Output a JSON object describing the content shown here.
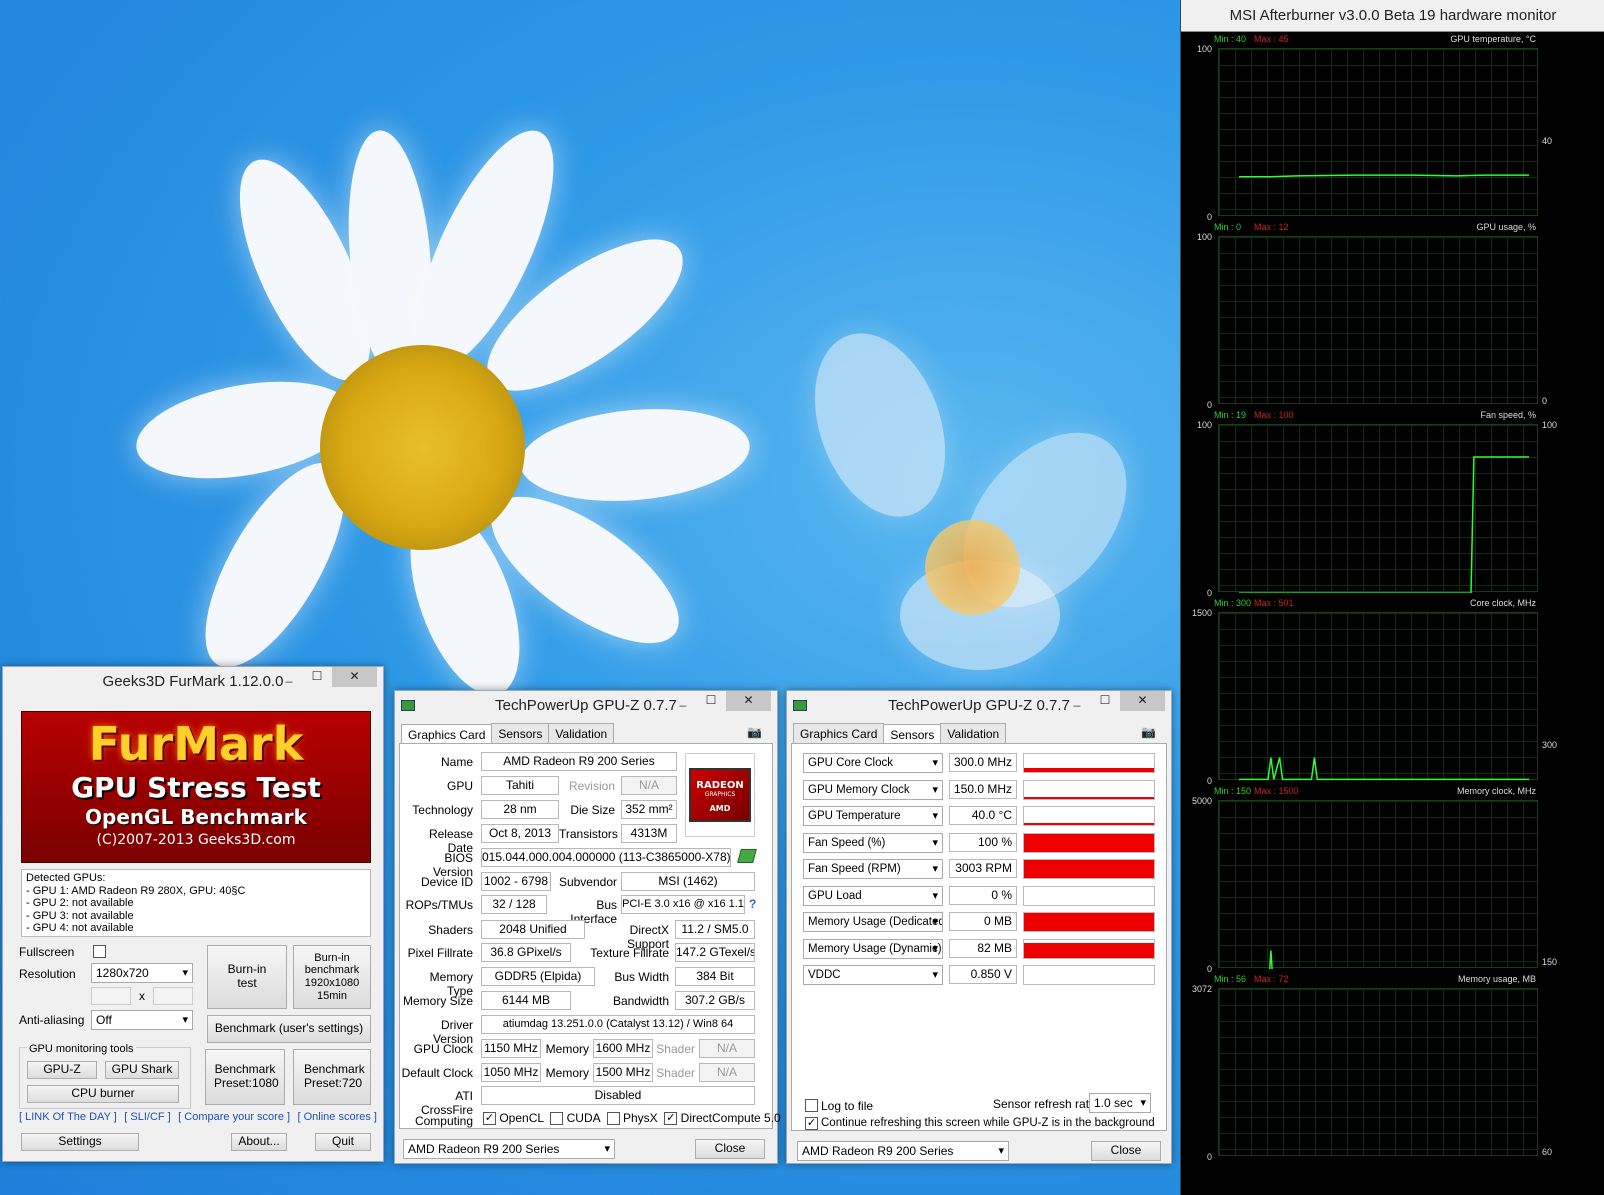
{
  "furmark": {
    "title": "Geeks3D FurMark 1.12.0.0",
    "logo_line1": "FurMark",
    "logo_line2": "GPU Stress Test",
    "logo_line3": "OpenGL Benchmark",
    "logo_line4": "(C)2007-2013 Geeks3D.com",
    "detected_header": "Detected GPUs:",
    "gpus": [
      "- GPU 1: AMD Radeon R9 280X, GPU: 40§C",
      "- GPU 2: not available",
      "- GPU 3: not available",
      "- GPU 4: not available"
    ],
    "fullscreen_label": "Fullscreen",
    "resolution_label": "Resolution",
    "resolution_value": "1280x720",
    "x_label": "x",
    "antialiasing_label": "Anti-aliasing",
    "antialiasing_value": "Off",
    "burnin_test": "Burn-in test",
    "burnin_benchmark": "Burn-in benchmark 1920x1080 15min",
    "benchmark_user": "Benchmark (user's settings)",
    "monitoring_label": "GPU monitoring tools",
    "gpuz_btn": "GPU-Z",
    "gpushark_btn": "GPU Shark",
    "cpuburner_btn": "CPU burner",
    "bench1080": "Benchmark Preset:1080",
    "bench720": "Benchmark Preset:720",
    "links": [
      "[ LINK Of The DAY ]",
      "[ SLI/CF ]",
      "[ Compare your score ]",
      "[ Online scores ]"
    ],
    "settings": "Settings",
    "about": "About...",
    "quit": "Quit"
  },
  "gpuz1": {
    "title": "TechPowerUp GPU-Z 0.7.7",
    "tabs": [
      "Graphics Card",
      "Sensors",
      "Validation"
    ],
    "name_label": "Name",
    "name": "AMD Radeon R9 200 Series",
    "gpu_label": "GPU",
    "gpu": "Tahiti",
    "revision_label": "Revision",
    "revision": "N/A",
    "tech_label": "Technology",
    "tech": "28 nm",
    "die_label": "Die Size",
    "die": "352 mm²",
    "release_label": "Release Date",
    "release": "Oct 8, 2013",
    "transistors_label": "Transistors",
    "transistors": "4313M",
    "bios_label": "BIOS Version",
    "bios": "015.044.000.004.000000 (113-C3865000-X78)",
    "device_label": "Device ID",
    "device": "1002 - 6798",
    "subvendor_label": "Subvendor",
    "subvendor": "MSI (1462)",
    "rops_label": "ROPs/TMUs",
    "rops": "32 / 128",
    "bus_label": "Bus Interface",
    "bus": "PCI-E 3.0 x16 @ x16 1.1",
    "shaders_label": "Shaders",
    "shaders": "2048 Unified",
    "dx_label": "DirectX Support",
    "dx": "11.2 / SM5.0",
    "pixel_label": "Pixel Fillrate",
    "pixel": "36.8 GPixel/s",
    "texture_label": "Texture Fillrate",
    "texture": "147.2 GTexel/s",
    "memtype_label": "Memory Type",
    "memtype": "GDDR5 (Elpida)",
    "buswidth_label": "Bus Width",
    "buswidth": "384 Bit",
    "memsize_label": "Memory Size",
    "memsize": "6144 MB",
    "bandwidth_label": "Bandwidth",
    "bandwidth": "307.2 GB/s",
    "driver_label": "Driver Version",
    "driver": "atiumdag 13.251.0.0 (Catalyst 13.12) / Win8 64",
    "gpuclock_label": "GPU Clock",
    "gpuclock": "1150 MHz",
    "memory_label": "Memory",
    "memclock": "1600 MHz",
    "shader_label": "Shader",
    "shaderclock": "N/A",
    "defclock_label": "Default Clock",
    "defclock": "1050 MHz",
    "defmem": "1500 MHz",
    "defshader": "N/A",
    "crossfire_label": "ATI CrossFire",
    "crossfire": "Disabled",
    "computing_label": "Computing",
    "opencl": "OpenCL",
    "cuda": "CUDA",
    "physx": "PhysX",
    "dc": "DirectCompute 5.0",
    "badge1": "RADEON",
    "badge2": "GRAPHICS",
    "badge3": "AMD",
    "select": "AMD Radeon R9 200 Series",
    "close": "Close"
  },
  "gpuz2": {
    "title": "TechPowerUp GPU-Z 0.7.7",
    "tabs": [
      "Graphics Card",
      "Sensors",
      "Validation"
    ],
    "sensors": [
      {
        "name": "GPU Core Clock",
        "value": "300.0 MHz",
        "level": 0.25
      },
      {
        "name": "GPU Memory Clock",
        "value": "150.0 MHz",
        "level": 0.1
      },
      {
        "name": "GPU Temperature",
        "value": "40.0 °C",
        "level": 0.1
      },
      {
        "name": "Fan Speed (%)",
        "value": "100 %",
        "level": 1.0
      },
      {
        "name": "Fan Speed (RPM)",
        "value": "3003 RPM",
        "level": 1.0
      },
      {
        "name": "GPU Load",
        "value": "0 %",
        "level": 0.0
      },
      {
        "name": "Memory Usage (Dedicated)",
        "value": "0 MB",
        "level": 1.0
      },
      {
        "name": "Memory Usage (Dynamic)",
        "value": "82 MB",
        "level": 0.8
      },
      {
        "name": "VDDC",
        "value": "0.850 V",
        "level": 0.0
      }
    ],
    "log_label": "Log to file",
    "refresh_label": "Sensor refresh rate:",
    "refresh_value": "1.0 sec",
    "continue_label": "Continue refreshing this screen while GPU-Z is in the background",
    "select": "AMD Radeon R9 200 Series",
    "close": "Close"
  },
  "afterburner": {
    "title": "MSI Afterburner v3.0.0 Beta 19 hardware monitor",
    "graphs": [
      {
        "name": "GPU temperature, °C",
        "min": "Min : 40",
        "max": "Max : 45",
        "top": "100",
        "bottom": "0",
        "current": "40"
      },
      {
        "name": "GPU usage, %",
        "min": "Min : 0",
        "max": "Max : 12",
        "top": "100",
        "bottom": "0",
        "current": "0"
      },
      {
        "name": "Fan speed, %",
        "min": "Min : 19",
        "max": "Max : 100",
        "top": "100",
        "bottom": "0",
        "current": "100"
      },
      {
        "name": "Core clock, MHz",
        "min": "Min : 300",
        "max": "Max : 501",
        "top": "1500",
        "bottom": "0",
        "current": "300"
      },
      {
        "name": "Memory clock, MHz",
        "min": "Min : 150",
        "max": "Max : 1500",
        "top": "5000",
        "bottom": "0",
        "current": "150"
      },
      {
        "name": "Memory usage, MB",
        "min": "Min : 56",
        "max": "Max : 72",
        "top": "3072",
        "bottom": "0",
        "current": "60"
      }
    ]
  }
}
